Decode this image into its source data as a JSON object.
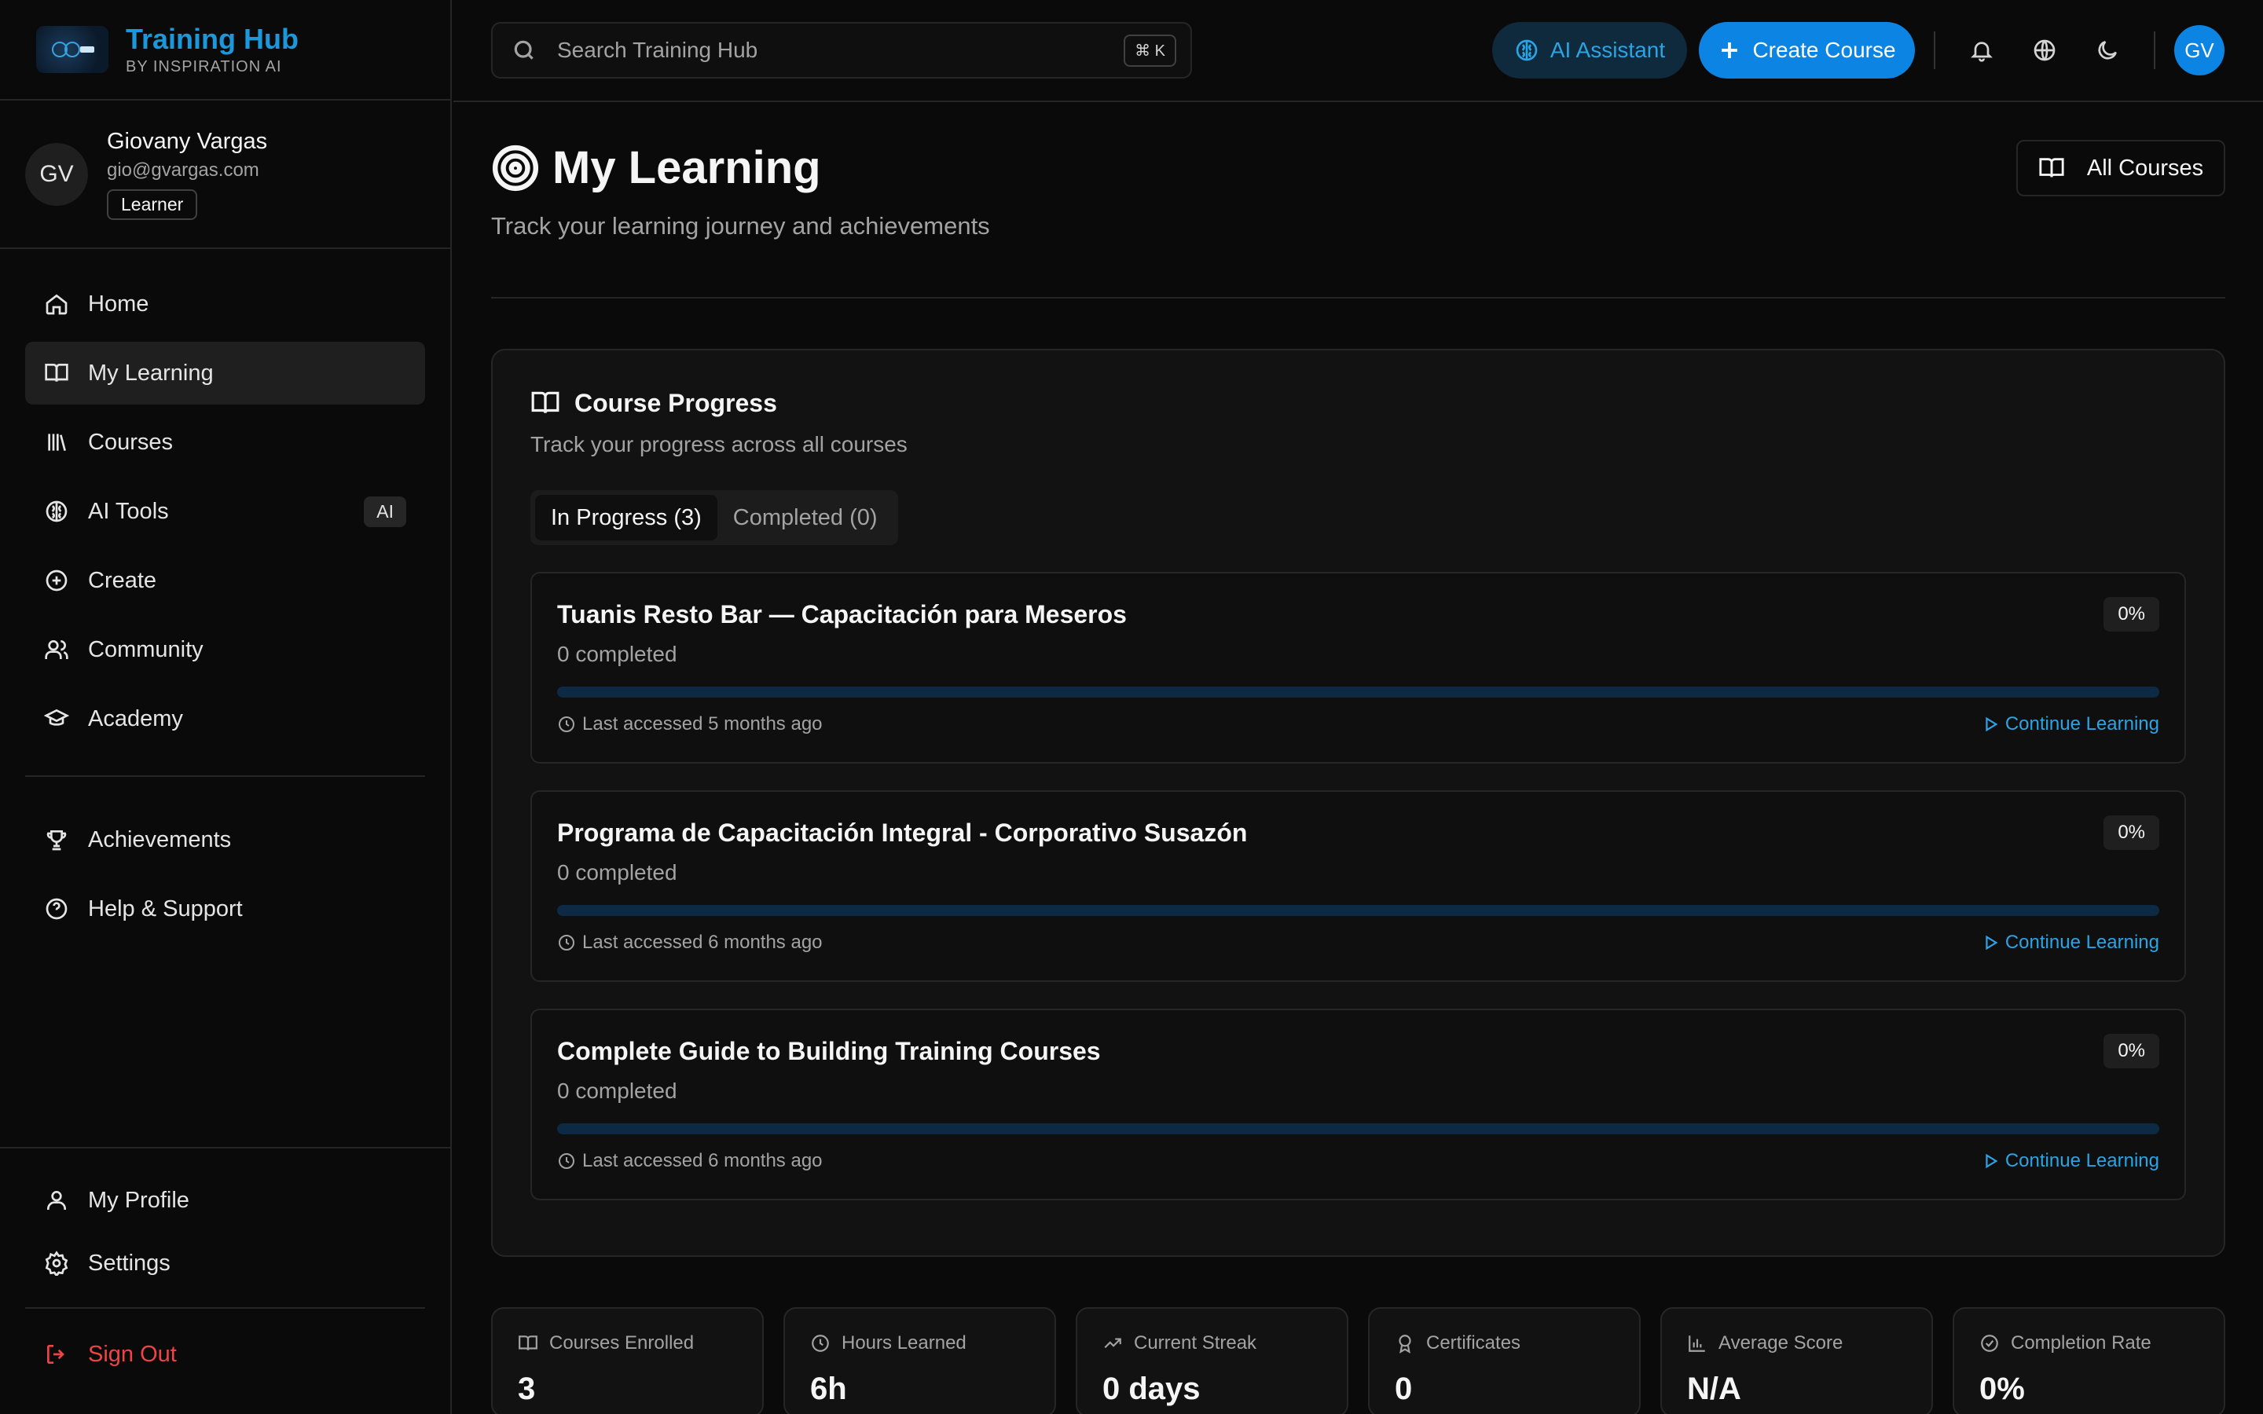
{
  "brand": {
    "title": "Training Hub",
    "subtitle": "BY INSPIRATION AI",
    "accent": "#1c97d9"
  },
  "user": {
    "initials": "GV",
    "name": "Giovany Vargas",
    "email": "gio@gvargas.com",
    "role": "Learner"
  },
  "sidebar": {
    "items": [
      {
        "label": "Home",
        "icon": "home-icon"
      },
      {
        "label": "My Learning",
        "icon": "book-open-icon",
        "active": true
      },
      {
        "label": "Courses",
        "icon": "library-icon"
      },
      {
        "label": "AI Tools",
        "icon": "brain-icon",
        "badge": "AI"
      },
      {
        "label": "Create",
        "icon": "plus-circle-icon"
      },
      {
        "label": "Community",
        "icon": "users-icon"
      },
      {
        "label": "Academy",
        "icon": "graduation-cap-icon"
      }
    ],
    "secondary": [
      {
        "label": "Achievements",
        "icon": "trophy-icon"
      },
      {
        "label": "Help & Support",
        "icon": "help-circle-icon"
      }
    ],
    "bottom": [
      {
        "label": "My Profile",
        "icon": "user-icon"
      },
      {
        "label": "Settings",
        "icon": "gear-icon"
      }
    ],
    "sign_out": "Sign Out"
  },
  "topbar": {
    "search_placeholder": "Search Training Hub",
    "shortcut": "⌘ K",
    "ai_assistant": "AI Assistant",
    "create_course": "Create Course",
    "avatar": "GV"
  },
  "page": {
    "title": "My Learning",
    "subtitle": "Track your learning journey and achievements",
    "all_courses": "All Courses"
  },
  "progress": {
    "title": "Course Progress",
    "subtitle": "Track your progress across all courses",
    "tabs": [
      {
        "label": "In Progress (3)",
        "active": true
      },
      {
        "label": "Completed (0)",
        "active": false
      }
    ],
    "courses": [
      {
        "title": "Tuanis Resto Bar — Capacitación para Meseros",
        "completed": "0 completed",
        "percent": "0%",
        "progress": 0,
        "last_accessed": "Last accessed 5 months ago",
        "action": "Continue Learning"
      },
      {
        "title": "Programa de Capacitación Integral - Corporativo Susazón",
        "completed": "0 completed",
        "percent": "0%",
        "progress": 0,
        "last_accessed": "Last accessed 6 months ago",
        "action": "Continue Learning"
      },
      {
        "title": "Complete Guide to Building Training Courses",
        "completed": "0 completed",
        "percent": "0%",
        "progress": 0,
        "last_accessed": "Last accessed 6 months ago",
        "action": "Continue Learning"
      }
    ]
  },
  "stats": [
    {
      "label": "Courses Enrolled",
      "value": "3",
      "icon": "book-open-icon"
    },
    {
      "label": "Hours Learned",
      "value": "6h",
      "icon": "clock-icon"
    },
    {
      "label": "Current Streak",
      "value": "0 days",
      "icon": "trending-up-icon"
    },
    {
      "label": "Certificates",
      "value": "0",
      "icon": "award-icon"
    },
    {
      "label": "Average Score",
      "value": "N/A",
      "icon": "bar-chart-icon"
    },
    {
      "label": "Completion Rate",
      "value": "0%",
      "icon": "check-circle-icon"
    }
  ],
  "colors": {
    "primary": "#0b84e3",
    "danger": "#ef4444",
    "background": "#0a0a0a"
  }
}
